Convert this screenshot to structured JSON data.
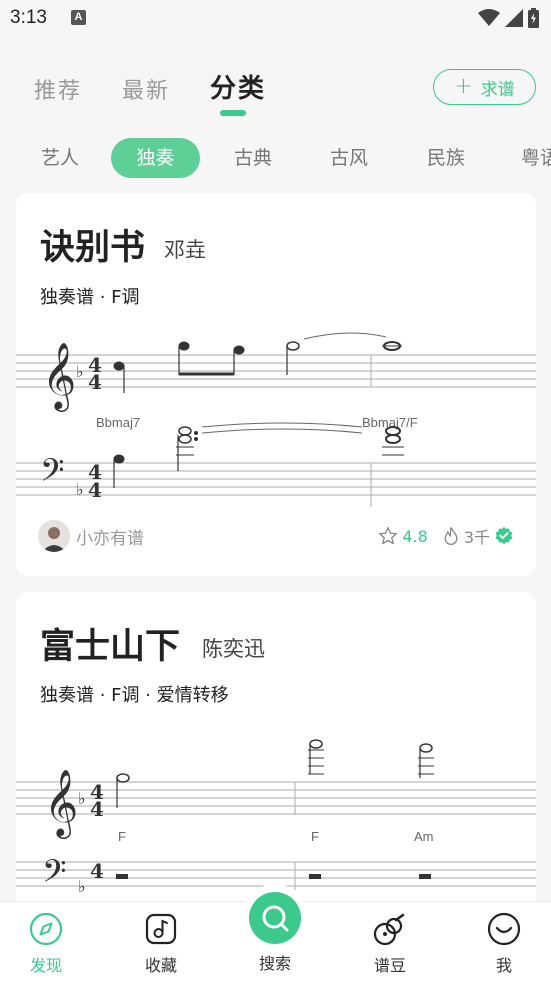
{
  "status_bar": {
    "time": "3:13",
    "notification_icon": "A"
  },
  "top_tabs": [
    {
      "label": "推荐",
      "active": false
    },
    {
      "label": "最新",
      "active": false
    },
    {
      "label": "分类",
      "active": true
    }
  ],
  "request_button": {
    "label": "求谱"
  },
  "categories": [
    "艺人",
    "独奏",
    "古典",
    "古风",
    "民族",
    "粤语"
  ],
  "active_category": "独奏",
  "cards": [
    {
      "title": "诀别书",
      "artist": "邓垚",
      "meta": "独奏谱 · F调",
      "chords": [
        "Bbmaj7",
        "Bbmaj7/F"
      ],
      "uploader": "小亦有谱",
      "rating": "4.8",
      "plays": "3千",
      "verified": true
    },
    {
      "title": "富士山下",
      "artist": "陈奕迅",
      "meta": "独奏谱 · F调 · 爱情转移",
      "chords": [
        "F",
        "F",
        "Am"
      ]
    }
  ],
  "bottom_nav": [
    {
      "label": "发现",
      "icon": "compass-icon",
      "active": true
    },
    {
      "label": "收藏",
      "icon": "music-note-icon",
      "active": false
    },
    {
      "label": "搜索",
      "icon": "search-icon",
      "active": false
    },
    {
      "label": "谱豆",
      "icon": "guitar-icon",
      "active": false
    },
    {
      "label": "我",
      "icon": "smile-icon",
      "active": false
    }
  ],
  "colors": {
    "accent": "#3cc98c",
    "chip_active": "#5ecf96"
  }
}
